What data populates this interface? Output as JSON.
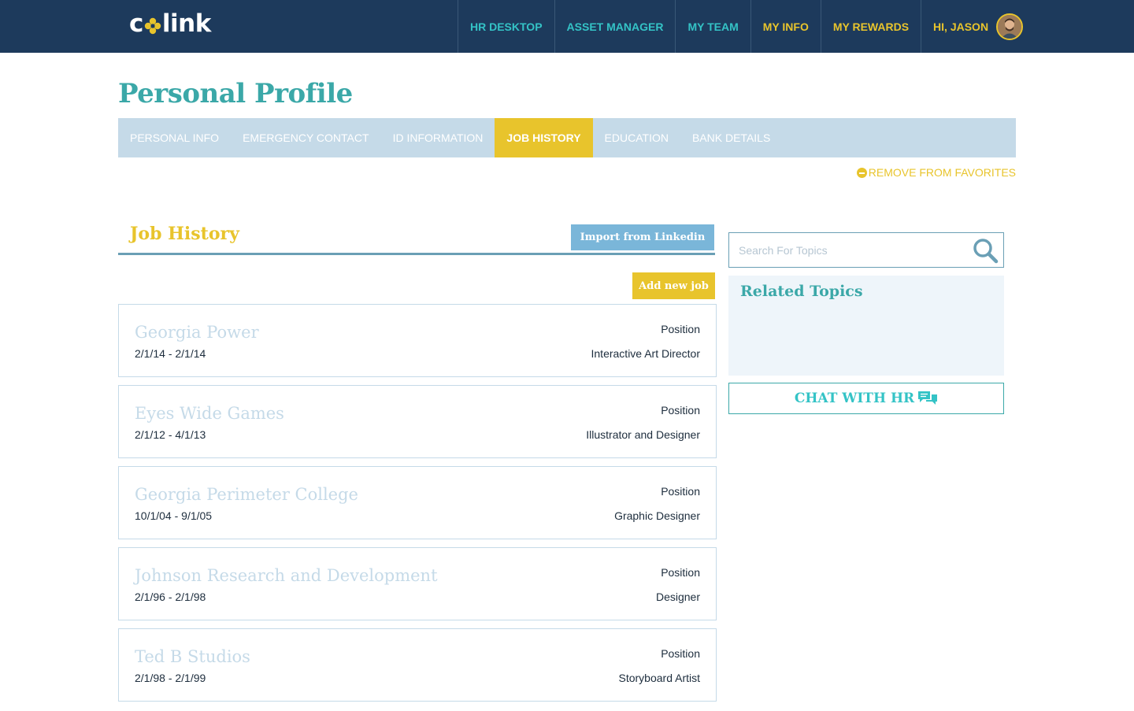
{
  "header": {
    "logo_text_pre": "c",
    "logo_text_post": "link",
    "nav": [
      {
        "label": "HR DESKTOP"
      },
      {
        "label": "ASSET MANAGER"
      },
      {
        "label": "MY TEAM"
      },
      {
        "label": "MY INFO"
      },
      {
        "label": "MY REWARDS"
      }
    ],
    "greeting": "HI, JASON"
  },
  "page": {
    "title": "Personal Profile",
    "tabs": [
      {
        "label": "PERSONAL INFO"
      },
      {
        "label": "EMERGENCY CONTACT"
      },
      {
        "label": "ID INFORMATION"
      },
      {
        "label": "JOB HISTORY"
      },
      {
        "label": "EDUCATION"
      },
      {
        "label": "BANK DETAILS"
      }
    ],
    "active_tab": "JOB HISTORY",
    "favorites_label": "REMOVE FROM FAVORITES"
  },
  "job_history": {
    "title": "Job History",
    "import_label": "Import from Linkedin",
    "add_label": "Add new job",
    "position_label": "Position",
    "jobs": [
      {
        "company": "Georgia Power",
        "dates": "2/1/14 - 2/1/14",
        "position": "Interactive Art Director"
      },
      {
        "company": "Eyes Wide Games",
        "dates": "2/1/12 - 4/1/13",
        "position": "Illustrator and Designer"
      },
      {
        "company": "Georgia Perimeter College",
        "dates": "10/1/04 - 9/1/05",
        "position": "Graphic Designer"
      },
      {
        "company": "Johnson Research and Development",
        "dates": "2/1/96 - 2/1/98",
        "position": "Designer"
      },
      {
        "company": "Ted B Studios",
        "dates": "2/1/98 - 2/1/99",
        "position": "Storyboard Artist"
      }
    ]
  },
  "sidebar": {
    "search_placeholder": "Search For Topics",
    "search_value": "",
    "related_title": "Related Topics",
    "chat_label": "CHAT WITH HR"
  },
  "colors": {
    "navy": "#1d3a5c",
    "teal": "#34c3c6",
    "yellow": "#e8c42c",
    "light_blue": "#c5dae8"
  },
  "icons": {
    "logo": "flower-icon",
    "search": "search-icon",
    "chat": "chat-bubbles-icon",
    "favorites": "minus-circle-icon"
  }
}
